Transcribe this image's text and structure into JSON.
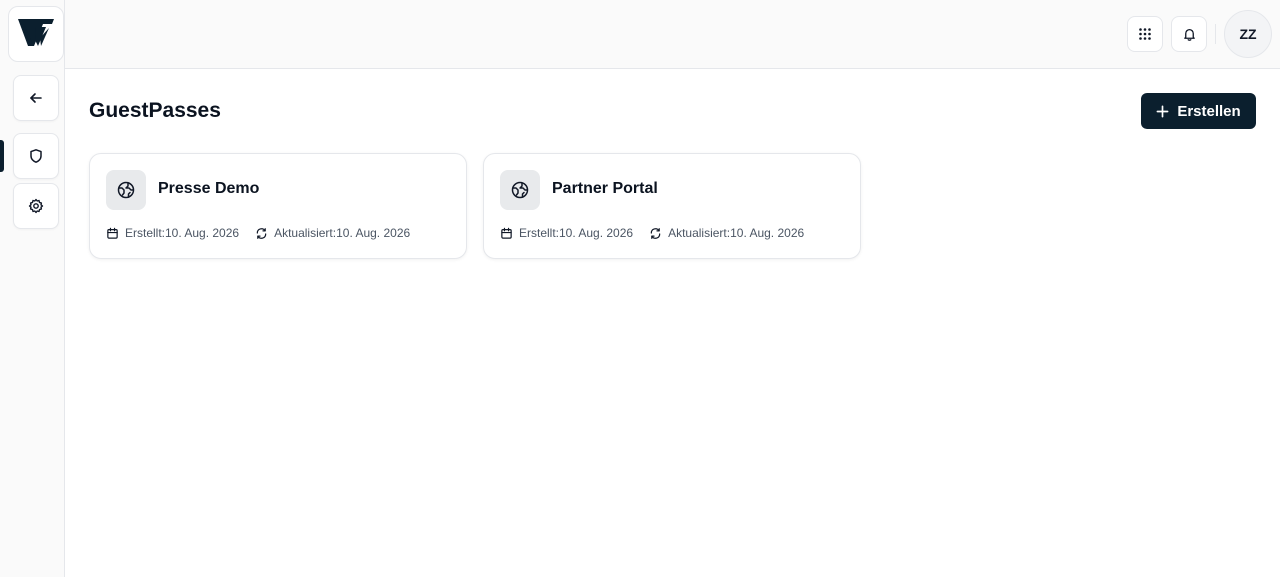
{
  "sidebar": {
    "logo_icon": "vault-logo-icon",
    "items": [
      {
        "name": "back",
        "icon": "arrow-left-icon"
      },
      {
        "name": "guest-passes",
        "icon": "shield-icon",
        "active": true
      },
      {
        "name": "settings",
        "icon": "gear-icon"
      }
    ]
  },
  "header": {
    "apps_icon": "grid-icon",
    "bell_icon": "bell-icon",
    "avatar_initials": "ZZ"
  },
  "main": {
    "title": "GuestPasses",
    "create_button": {
      "label": "Erstellen",
      "icon": "plus-icon"
    },
    "cards": [
      {
        "title": "Presse Demo",
        "icon": "globe-icon",
        "created": "Erstellt:10. Aug. 2026",
        "updated": "Aktualisiert:10. Aug. 2026"
      },
      {
        "title": "Partner Portal",
        "icon": "globe-icon",
        "created": "Erstellt:10. Aug. 2026",
        "updated": "Aktualisiert:10. Aug. 2026"
      }
    ]
  },
  "colors": {
    "primary": "#0b1f2e",
    "background": "#fafafa",
    "border": "#e5e7eb"
  }
}
